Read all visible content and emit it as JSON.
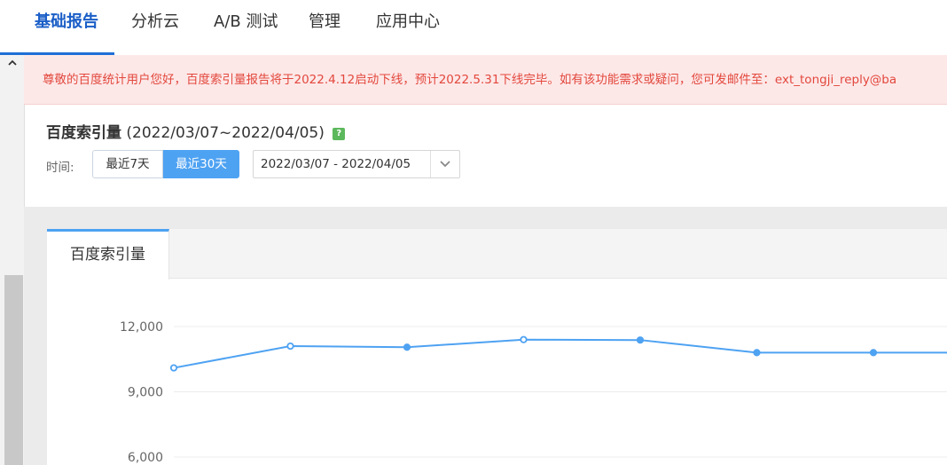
{
  "nav": {
    "items": [
      {
        "label": "基础报告",
        "active": true
      },
      {
        "label": "分析云",
        "active": false
      },
      {
        "label": "A/B 测试",
        "active": false
      },
      {
        "label": "管理",
        "active": false
      },
      {
        "label": "应用中心",
        "active": false
      }
    ]
  },
  "notice": {
    "text": "尊敬的百度统计用户您好，百度索引量报告将于2022.4.12启动下线，预计2022.5.31下线完毕。如有该功能需求或疑问，您可发邮件至：ext_tongji_reply@ba"
  },
  "report": {
    "title": "百度索引量",
    "range": "(2022/03/07~2022/04/05)",
    "help": "?"
  },
  "time_filter": {
    "label": "时间:",
    "btn_7": "最近7天",
    "btn_30": "最近30天",
    "selected": "最近30天",
    "date_range": "2022/03/07 - 2022/04/05"
  },
  "tabs": [
    {
      "label": "百度索引量",
      "active": true
    }
  ],
  "colors": {
    "accent": "#4ea2f2",
    "nav_active": "#1a5ec7",
    "notice_text": "#e2483d",
    "notice_bg": "#fde8e8"
  },
  "icons": {
    "scroll_up": "chevron-up-icon",
    "date_dropdown": "chevron-down-icon",
    "help": "help-icon"
  },
  "chart_data": {
    "type": "line",
    "title": "",
    "xlabel": "",
    "ylabel": "",
    "y_ticks": [
      "12,000",
      "9,000",
      "6,000"
    ],
    "y_tick_values": [
      12000,
      9000,
      6000
    ],
    "ylim": [
      6000,
      12000
    ],
    "grid": true,
    "series": [
      {
        "values": [
          10100,
          11100,
          11050,
          11400,
          11380,
          10800,
          10800,
          10800
        ]
      }
    ]
  }
}
